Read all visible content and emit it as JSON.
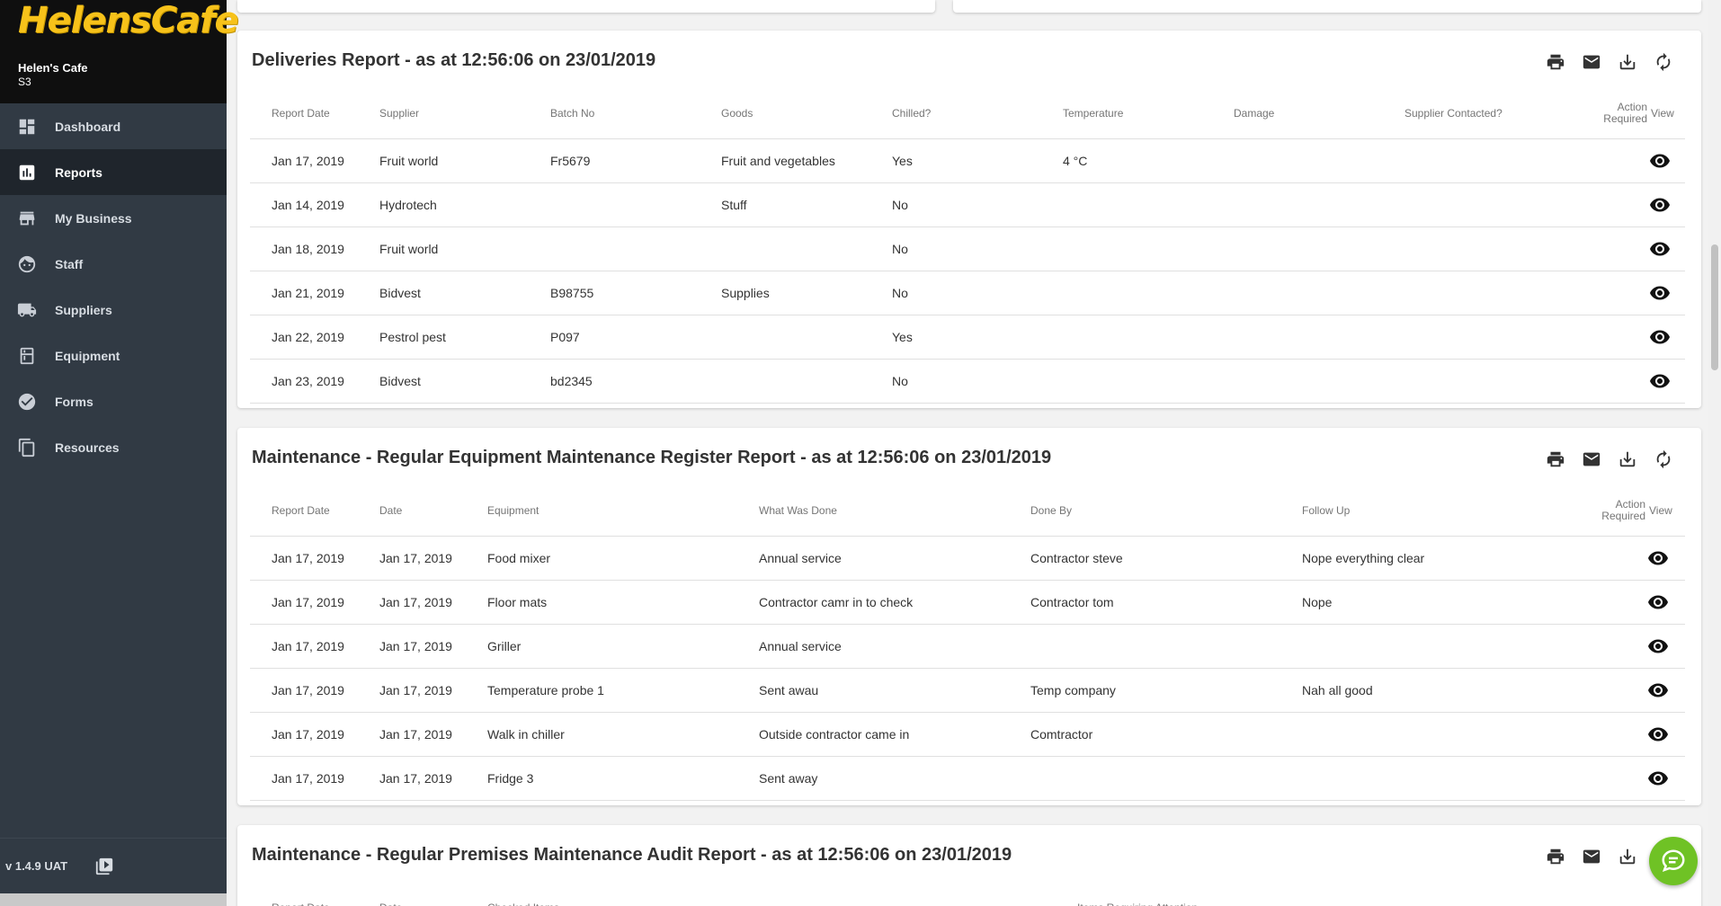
{
  "brand": {
    "logo_text": "HelensCafe",
    "business_name": "Helen's Cafe",
    "business_code": "S3"
  },
  "sidebar": {
    "items": [
      {
        "label": "Dashboard",
        "icon": "dashboard-icon"
      },
      {
        "label": "Reports",
        "icon": "bar-chart-icon",
        "active": true
      },
      {
        "label": "My Business",
        "icon": "store-icon"
      },
      {
        "label": "Staff",
        "icon": "face-icon"
      },
      {
        "label": "Suppliers",
        "icon": "truck-icon"
      },
      {
        "label": "Equipment",
        "icon": "fridge-icon"
      },
      {
        "label": "Forms",
        "icon": "check-circle-icon"
      },
      {
        "label": "Resources",
        "icon": "copy-icon"
      }
    ],
    "version": "v 1.4.9 UAT"
  },
  "reports": [
    {
      "title": "Deliveries Report - as at 12:56:06 on 23/01/2019",
      "columns": [
        "Report Date",
        "Supplier",
        "Batch No",
        "Goods",
        "Chilled?",
        "Temperature",
        "Damage",
        "Supplier Contacted?"
      ],
      "action_label_1": "Action",
      "action_label_2": "Required",
      "view_label": "View",
      "rows": [
        [
          "Jan 17, 2019",
          "Fruit world",
          "Fr5679",
          "Fruit and vegetables",
          "Yes",
          "4 °C",
          "",
          ""
        ],
        [
          "Jan 14, 2019",
          "Hydrotech",
          "",
          "Stuff",
          "No",
          "",
          "",
          ""
        ],
        [
          "Jan 18, 2019",
          "Fruit world",
          "",
          "",
          "No",
          "",
          "",
          ""
        ],
        [
          "Jan 21, 2019",
          "Bidvest",
          "B98755",
          "Supplies",
          "No",
          "",
          "",
          ""
        ],
        [
          "Jan 22, 2019",
          "Pestrol pest",
          "P097",
          "",
          "Yes",
          "",
          "",
          ""
        ],
        [
          "Jan 23, 2019",
          "Bidvest",
          "bd2345",
          "",
          "No",
          "",
          "",
          ""
        ]
      ]
    },
    {
      "title": "Maintenance - Regular Equipment Maintenance Register Report - as at 12:56:06 on 23/01/2019",
      "columns": [
        "Report Date",
        "Date",
        "Equipment",
        "What Was Done",
        "Done By",
        "Follow Up"
      ],
      "action_label_1": "Action",
      "action_label_2": "Required",
      "view_label": "View",
      "rows": [
        [
          "Jan 17, 2019",
          "Jan 17, 2019",
          "Food mixer",
          "Annual service",
          "Contractor steve",
          "Nope everything clear"
        ],
        [
          "Jan 17, 2019",
          "Jan 17, 2019",
          "Floor mats",
          "Contractor camr in to check",
          "Contractor tom",
          "Nope"
        ],
        [
          "Jan 17, 2019",
          "Jan 17, 2019",
          "Griller",
          "Annual service",
          "",
          ""
        ],
        [
          "Jan 17, 2019",
          "Jan 17, 2019",
          "Temperature probe 1",
          "Sent awau",
          "Temp company",
          "Nah all good"
        ],
        [
          "Jan 17, 2019",
          "Jan 17, 2019",
          "Walk in chiller",
          "Outside contractor came in",
          "Comtractor",
          ""
        ],
        [
          "Jan 17, 2019",
          "Jan 17, 2019",
          "Fridge 3",
          "Sent away",
          "",
          ""
        ]
      ]
    },
    {
      "title": "Maintenance - Regular Premises Maintenance Audit Report - as at 12:56:06 on 23/01/2019",
      "columns": [
        "Report Date",
        "Date",
        "Checked Items",
        "Items Requiring Attention"
      ],
      "rows": []
    }
  ],
  "colors": {
    "sidebar_bg": "#313a44",
    "brand_bg": "#0f0f0f",
    "logo": "#f7c21a",
    "chat_button": "#6fc225"
  }
}
